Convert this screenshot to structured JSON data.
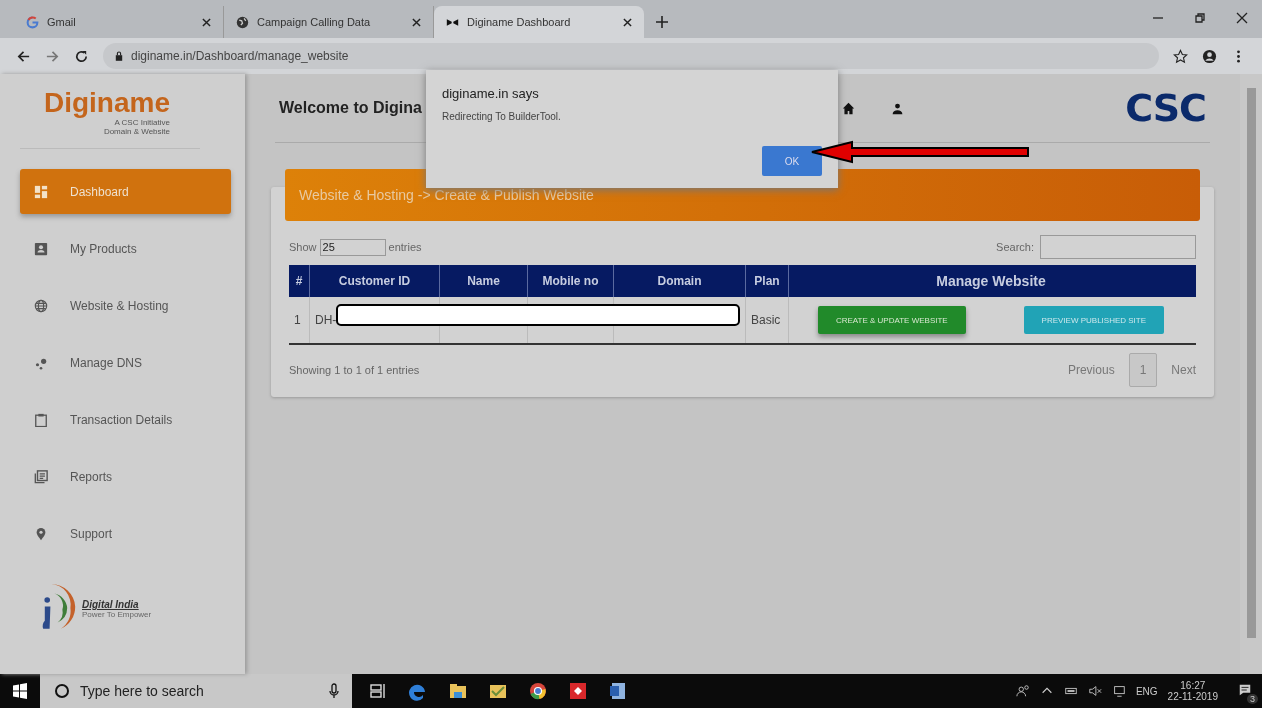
{
  "browser": {
    "tabs": [
      {
        "title": "Gmail",
        "selected": false
      },
      {
        "title": "Campaign Calling Data",
        "selected": false
      },
      {
        "title": "Diginame Dashboard",
        "selected": true
      }
    ],
    "url": "diginame.in/Dashboard/manage_website"
  },
  "brand": {
    "name": "Diginame",
    "tagline": "A CSC Initiative",
    "sub": "Domain & Website"
  },
  "sidebar": {
    "items": [
      {
        "label": "Dashboard",
        "selected": true
      },
      {
        "label": "My Products",
        "selected": false
      },
      {
        "label": "Website & Hosting",
        "selected": false
      },
      {
        "label": "Manage DNS",
        "selected": false
      },
      {
        "label": "Transaction Details",
        "selected": false
      },
      {
        "label": "Reports",
        "selected": false
      },
      {
        "label": "Support",
        "selected": false
      }
    ],
    "footer_logo": {
      "title": "Digital India",
      "tagline": "Power To Empower"
    }
  },
  "header": {
    "title": "Welcome to Digina",
    "logo": "CSC"
  },
  "panel": {
    "title": "Website & Hosting -> Create & Publish Website",
    "show_label": "Show",
    "page_size": "25",
    "entries_label": "entries",
    "search_label": "Search:",
    "columns": [
      "#",
      "Customer ID",
      "Name",
      "Mobile no",
      "Domain",
      "Plan",
      "Manage Website"
    ],
    "rows": [
      {
        "index": "1",
        "customer_id": "DH-",
        "plan": "Basic",
        "actions": [
          {
            "label": "CREATE & UPDATE WEBSITE",
            "kind": "create"
          },
          {
            "label": "PREVIEW PUBLISHED SITE",
            "kind": "preview"
          }
        ]
      }
    ],
    "info": "Showing 1 to 1 of 1 entries",
    "pagination": [
      {
        "label": "Previous",
        "selected": false
      },
      {
        "label": "1",
        "selected": true
      },
      {
        "label": "Next",
        "selected": false
      }
    ]
  },
  "dialog": {
    "title": "diginame.in says",
    "message": "Redirecting To BuilderTool.",
    "button": "OK"
  },
  "taskbar": {
    "search_placeholder": "Type here to search",
    "language": "ENG",
    "time": "16:27",
    "date": "22-11-2019",
    "notifications": "3"
  }
}
